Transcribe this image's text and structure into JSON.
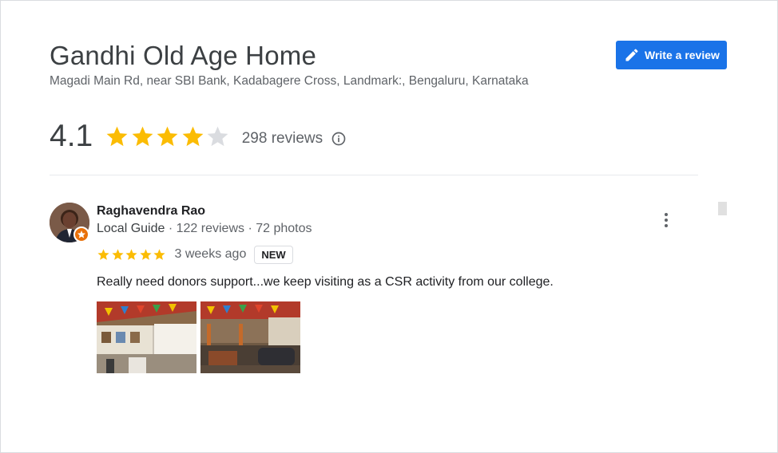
{
  "place": {
    "title": "Gandhi Old Age Home",
    "address": "Magadi Main Rd, near SBI Bank, Kadabagere Cross, Landmark:, Bengaluru, Karnataka"
  },
  "actions": {
    "write_review_label": "Write a review"
  },
  "rating": {
    "value": "4.1",
    "stars": 4.1,
    "reviews_label": "298 reviews"
  },
  "review": {
    "reviewer_name": "Raghavendra Rao",
    "reviewer_role": "Local Guide",
    "reviewer_reviews": "122 reviews",
    "reviewer_photos": "72 photos",
    "separator": "·",
    "stars": 5,
    "date": "3 weeks ago",
    "badge": "NEW",
    "text": "Really need donors support...we keep visiting as a CSR activity from our college.",
    "photos": [
      {
        "icon": "photo-thumbnail"
      },
      {
        "icon": "photo-thumbnail"
      }
    ]
  },
  "colors": {
    "accent": "#1a73e8",
    "star": "#fbbc04",
    "star_empty": "#dadce0",
    "guide_badge": "#e8710a"
  }
}
